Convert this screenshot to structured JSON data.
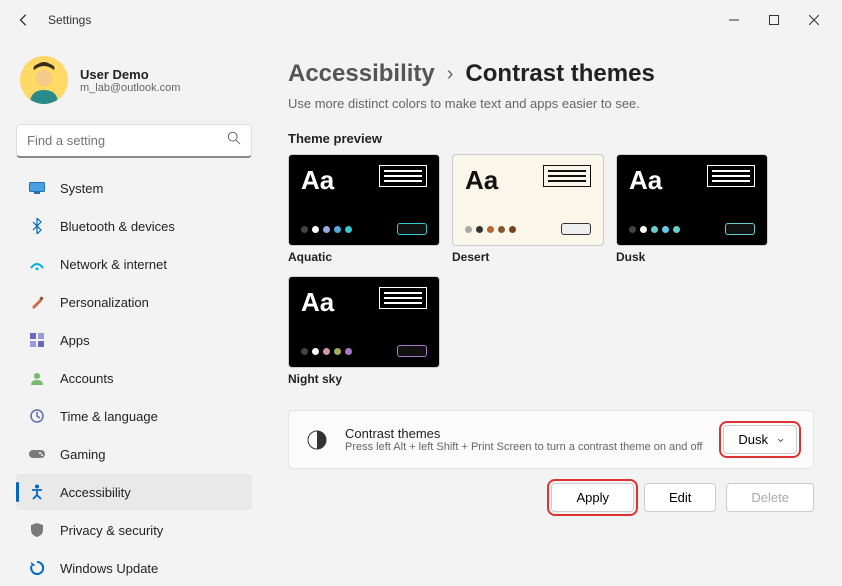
{
  "window": {
    "title": "Settings"
  },
  "user": {
    "name": "User Demo",
    "email": "m_lab@outlook.com"
  },
  "search": {
    "placeholder": "Find a setting"
  },
  "nav": [
    {
      "icon": "system",
      "label": "System",
      "color": "#0078d4"
    },
    {
      "icon": "bluetooth",
      "label": "Bluetooth & devices",
      "color": "#0067c0"
    },
    {
      "icon": "network",
      "label": "Network & internet",
      "color": "#00b0d8"
    },
    {
      "icon": "personalization",
      "label": "Personalization",
      "color": "#d06a4a"
    },
    {
      "icon": "apps",
      "label": "Apps",
      "color": "#6a6bbf"
    },
    {
      "icon": "accounts",
      "label": "Accounts",
      "color": "#7aba6c"
    },
    {
      "icon": "time",
      "label": "Time & language",
      "color": "#5a6dac"
    },
    {
      "icon": "gaming",
      "label": "Gaming",
      "color": "#7a7a7a"
    },
    {
      "icon": "accessibility",
      "label": "Accessibility",
      "color": "#0067c0",
      "active": true
    },
    {
      "icon": "privacy",
      "label": "Privacy & security",
      "color": "#7a7a7a"
    },
    {
      "icon": "update",
      "label": "Windows Update",
      "color": "#0067c0"
    }
  ],
  "breadcrumb": {
    "parent": "Accessibility",
    "current": "Contrast themes"
  },
  "subtitle": "Use more distinct colors to make text and apps easier to see.",
  "preview_label": "Theme preview",
  "themes": [
    {
      "name": "Aquatic",
      "bg": "dark",
      "fg": "white",
      "dots": [
        "#444",
        "#fff",
        "#9ad",
        "#5ad",
        "#3cc"
      ],
      "btn": "#3cc"
    },
    {
      "name": "Desert",
      "bg": "light",
      "fg": "black",
      "dots": [
        "#aaa",
        "#333",
        "#b63",
        "#853",
        "#742"
      ],
      "btn": "#333"
    },
    {
      "name": "Dusk",
      "bg": "dark",
      "fg": "white",
      "dots": [
        "#444",
        "#fff",
        "#6cc",
        "#6ce",
        "#6cc"
      ],
      "btn": "#6cc"
    },
    {
      "name": "Night sky",
      "bg": "dark",
      "fg": "white",
      "dots": [
        "#444",
        "#fff",
        "#c9a",
        "#aa5",
        "#a7c"
      ],
      "btn": "#a7c"
    }
  ],
  "panel": {
    "title": "Contrast themes",
    "sub": "Press left Alt + left Shift + Print Screen to turn a contrast theme on and off",
    "selected": "Dusk"
  },
  "actions": {
    "apply": "Apply",
    "edit": "Edit",
    "delete": "Delete"
  }
}
